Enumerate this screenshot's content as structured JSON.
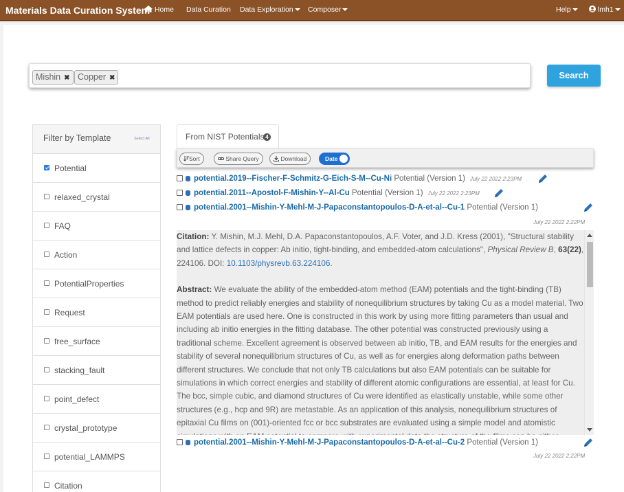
{
  "nav": {
    "brand": "Materials Data Curation System",
    "home": "Home",
    "data_curation": "Data Curation",
    "data_exploration": "Data Exploration",
    "composer": "Composer",
    "help": "Help",
    "user": "lmh1"
  },
  "search": {
    "chips": [
      "Mishin",
      "Copper"
    ],
    "button": "Search"
  },
  "filter": {
    "title": "Filter by Template",
    "select_all": "Select All",
    "items": [
      {
        "label": "Potential",
        "checked": true
      },
      {
        "label": "relaxed_crystal",
        "checked": false
      },
      {
        "label": "FAQ",
        "checked": false
      },
      {
        "label": "Action",
        "checked": false
      },
      {
        "label": "PotentialProperties",
        "checked": false
      },
      {
        "label": "Request",
        "checked": false
      },
      {
        "label": "free_surface",
        "checked": false
      },
      {
        "label": "stacking_fault",
        "checked": false
      },
      {
        "label": "point_defect",
        "checked": false
      },
      {
        "label": "crystal_prototype",
        "checked": false
      },
      {
        "label": "potential_LAMMPS",
        "checked": false
      },
      {
        "label": "Citation",
        "checked": false
      }
    ]
  },
  "results_tab": {
    "label": "From NIST Potentials",
    "count": "4"
  },
  "toolbar": {
    "sort": "Sort",
    "share": "Share Query",
    "download": "Download",
    "date_toggle": "Date"
  },
  "results": [
    {
      "title": "potential.2019--Fischer-F-Schmitz-G-Eich-S-M--Cu-Ni",
      "type": "Potential (Version 1)",
      "date": "July 22 2022 2:23PM"
    },
    {
      "title": "potential.2011--Apostol-F-Mishin-Y--Al-Cu",
      "type": "Potential (Version 1)",
      "date": "July 22 2022 2:23PM"
    },
    {
      "title": "potential.2001--Mishin-Y-Mehl-M-J-Papaconstantopoulos-D-A-et-al--Cu-1",
      "type": "Potential (Version 1)",
      "date": "July 22 2022 2:22PM"
    },
    {
      "title": "potential.2001--Mishin-Y-Mehl-M-J-Papaconstantopoulos-D-A-et-al--Cu-2",
      "type": "Potential (Version 1)",
      "date": "July 22 2022 2:22PM"
    }
  ],
  "detail": {
    "citation_label": "Citation:",
    "citation_text": "Y. Mishin, M.J. Mehl, D.A. Papaconstantopoulos, A.F. Voter, and J.D. Kress (2001), \"Structural stability and lattice defects in copper: Ab initio, tight-binding, and embedded-atom calculations\",",
    "journal": "Physical Review B",
    "volume": "63",
    "issue": "(22)",
    "pages": ", 224106. DOI:",
    "doi": "10.1103/physrevb.63.224106",
    "doi_end": ".",
    "abstract_label": "Abstract:",
    "abstract_text": "We evaluate the ability of the embedded-atom method (EAM) potentials and the tight-binding (TB) method to predict reliably energies and stability of nonequilibrium structures by taking Cu as a model material. Two EAM potentials are used here. One is constructed in this work by using more fitting parameters than usual and including ab initio energies in the fitting database. The other potential was constructed previously using a traditional scheme. Excellent agreement is observed between ab initio, TB, and EAM results for the energies and stability of several nonequilibrium structures of Cu, as well as for energies along deformation paths between different structures. We conclude that not only TB calculations but also EAM potentials can be suitable for simulations in which correct energies and stability of different atomic configurations are essential, at least for Cu. The bcc, simple cubic, and diamond structures of Cu were identified as elastically unstable, while some other structures (e.g., hcp and 9R) are metastable. As an application of this analysis, nonequilibrium structures of epitaxial Cu films on (001)-oriented fcc or bcc substrates are evaluated using a simple model and atomistic simulations with an EAM potential to compare with experimental data the structure of the films can be either"
  },
  "colors": {
    "navbar": "#8b5227",
    "search_button": "#2ea3dd",
    "link": "#1a6aa7",
    "toggle": "#1f6fd1"
  }
}
